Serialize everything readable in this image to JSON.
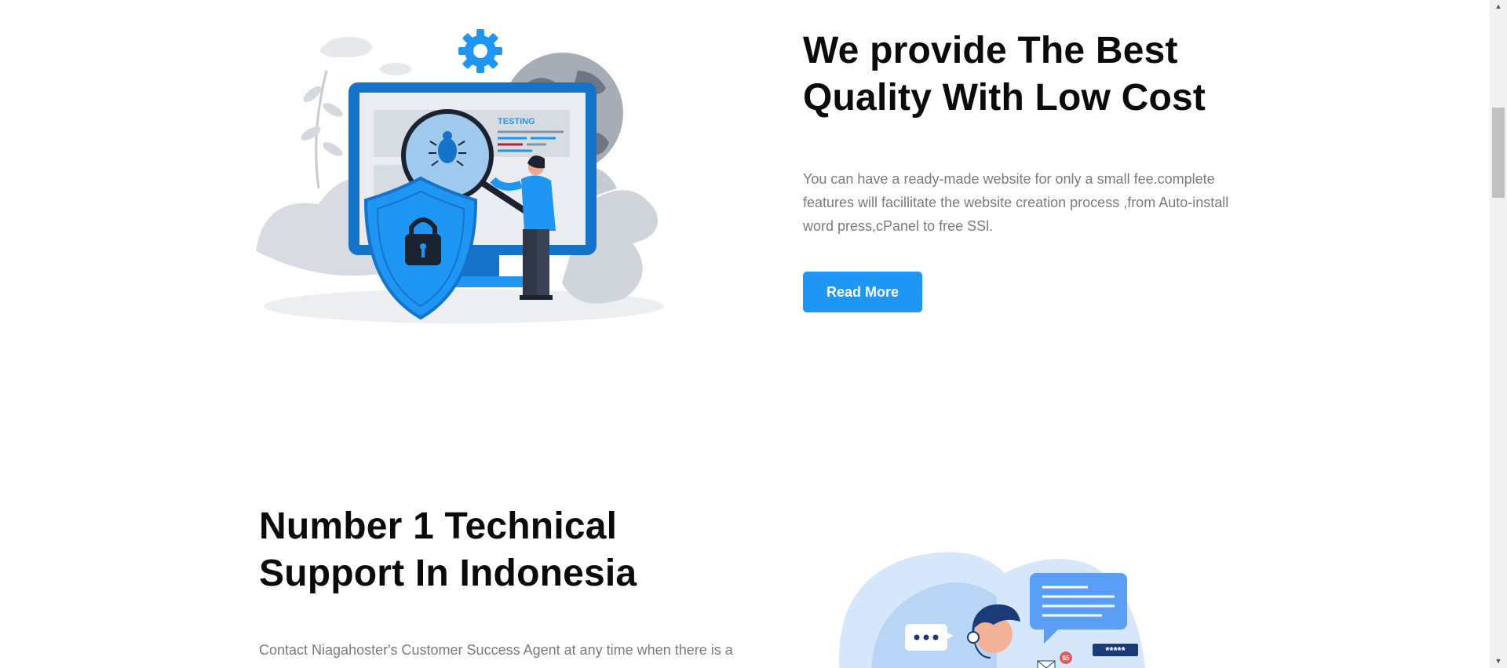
{
  "section1": {
    "heading_line1": "We provide The Best",
    "heading_line2": "Quality With Low Cost",
    "paragraph": "You can have a ready-made website for only a small fee.complete features will facillitate the website creation process ,from Auto-install word press,cPanel to free SSl.",
    "button_label": "Read More",
    "illustration_label": "TESTING"
  },
  "section2": {
    "heading_line1": "Number 1 Technical",
    "heading_line2": "Support In Indonesia",
    "paragraph": "Contact Niagahoster's Customer Success Agent at any time when there is a",
    "password_mask": "*****",
    "price_badge": "$5"
  },
  "colors": {
    "accent": "#1f96f3",
    "heading": "#0b0b0b",
    "body_text": "#7b7b7b"
  }
}
